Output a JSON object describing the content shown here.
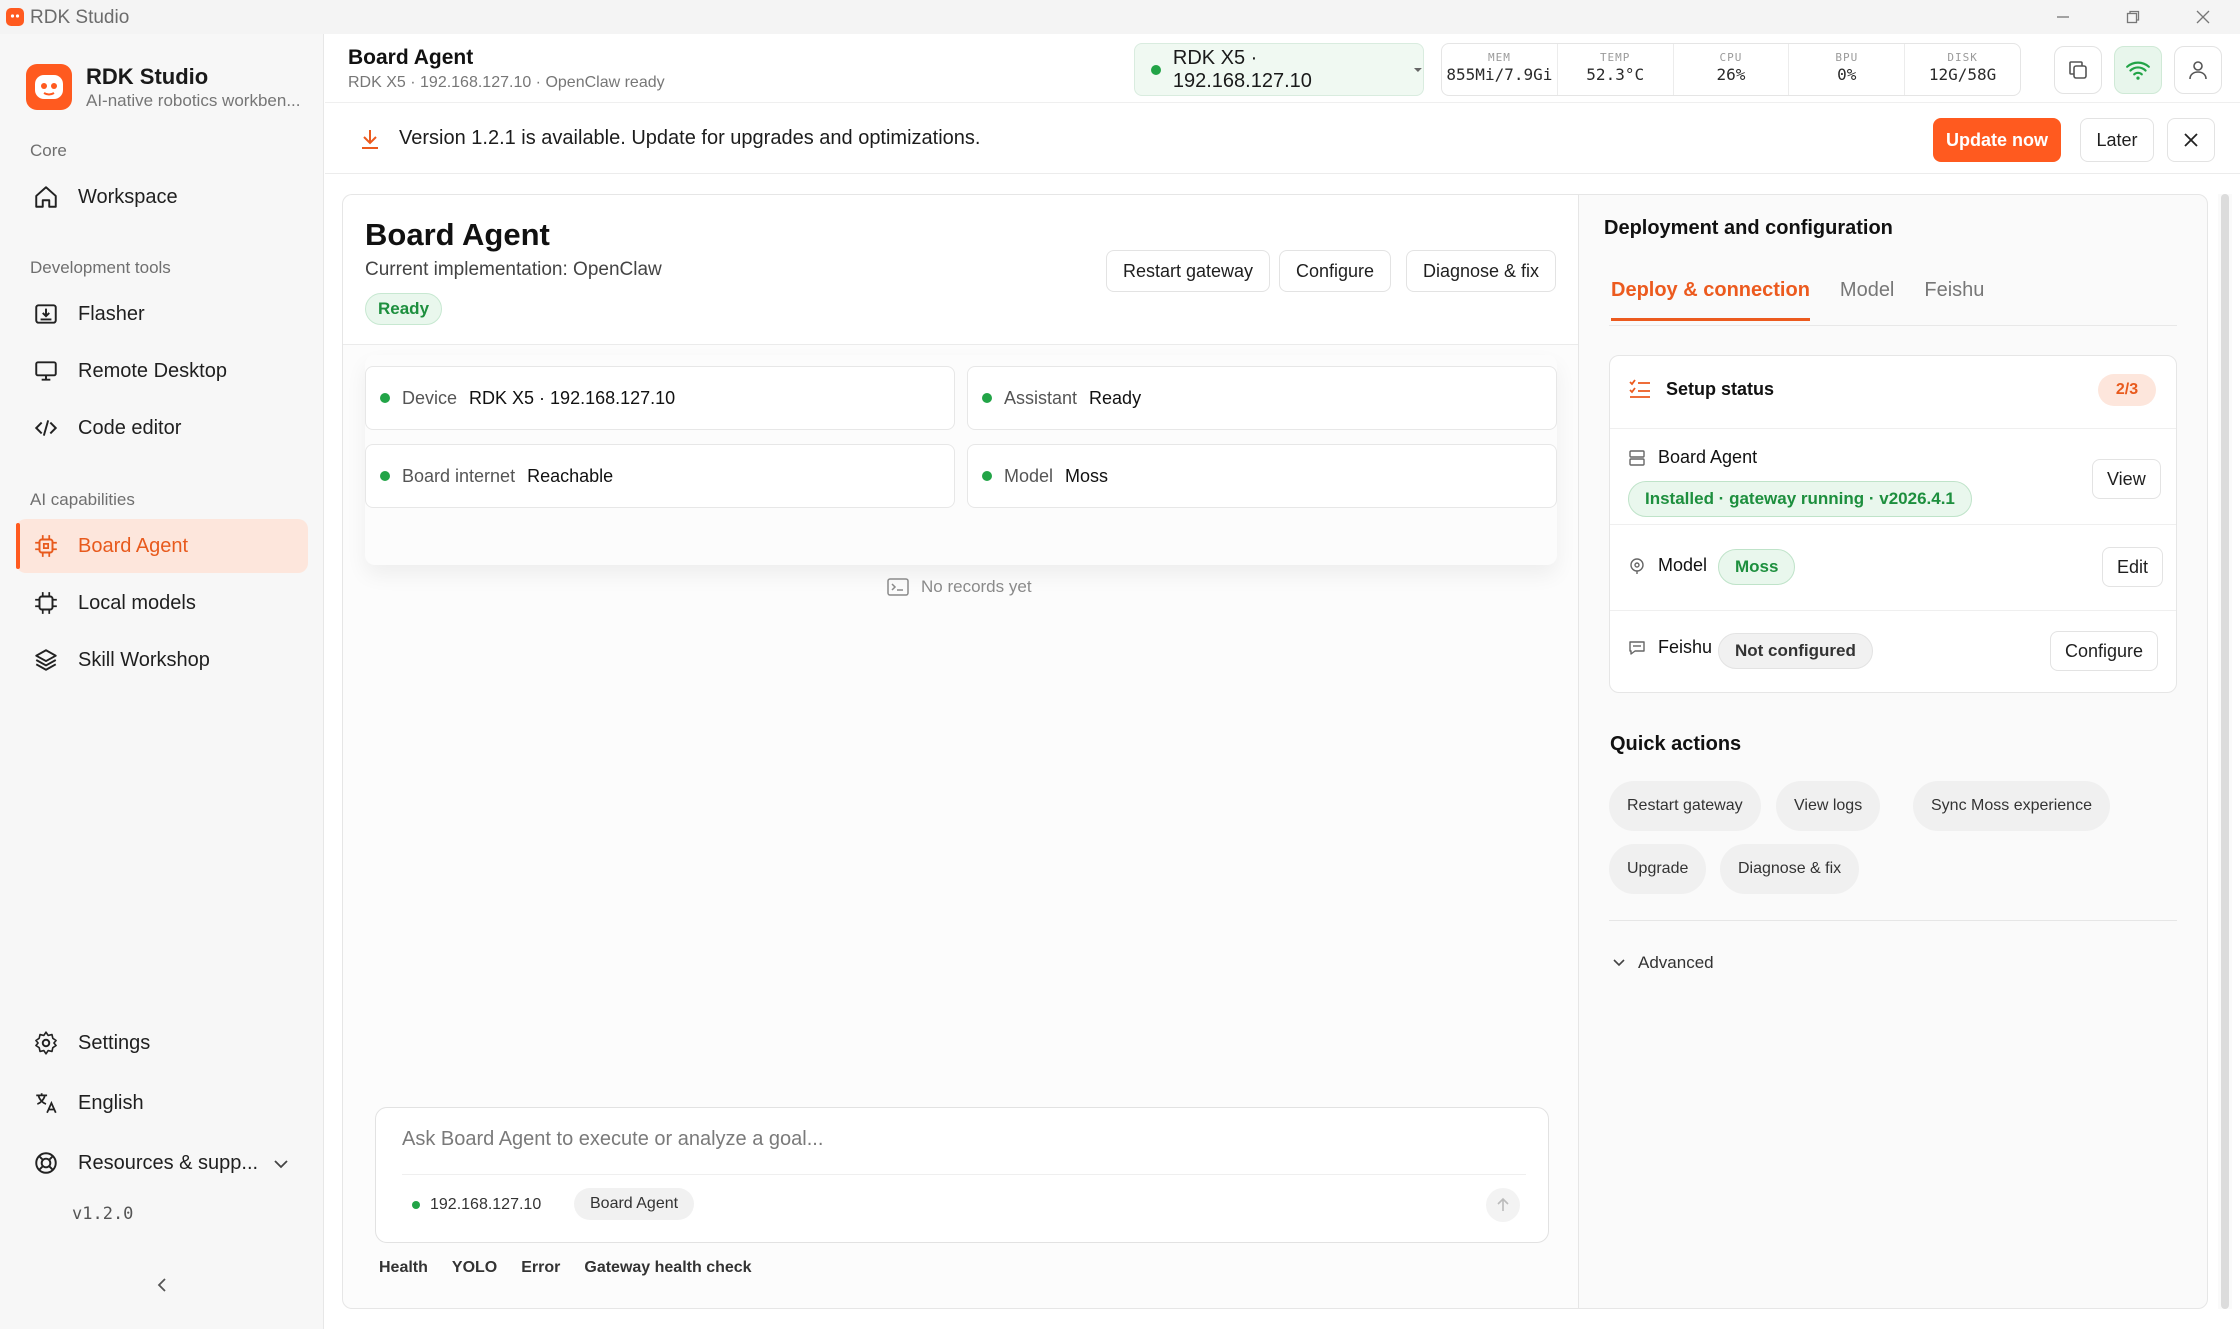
{
  "window": {
    "title": "RDK Studio"
  },
  "sidebar": {
    "brand_title": "RDK Studio",
    "brand_subtitle": "AI-native robotics workben...",
    "sections": {
      "core": "Core",
      "dev_tools": "Development tools",
      "ai": "AI capabilities"
    },
    "items": {
      "workspace": "Workspace",
      "flasher": "Flasher",
      "remote_desktop": "Remote Desktop",
      "code_editor": "Code editor",
      "board_agent": "Board Agent",
      "local_models": "Local models",
      "skill_workshop": "Skill Workshop",
      "settings": "Settings",
      "language": "English",
      "resources": "Resources & supp..."
    },
    "version": "v1.2.0"
  },
  "header": {
    "title": "Board Agent",
    "subtitle": "RDK X5 · 192.168.127.10 · OpenClaw ready",
    "device": "RDK X5 · 192.168.127.10",
    "stats": [
      {
        "key": "MEM",
        "value": "855Mi/7.9Gi"
      },
      {
        "key": "TEMP",
        "value": "52.3°C"
      },
      {
        "key": "CPU",
        "value": "26%"
      },
      {
        "key": "BPU",
        "value": "0%"
      },
      {
        "key": "DISK",
        "value": "12G/58G"
      }
    ]
  },
  "banner": {
    "text": "Version 1.2.1 is available. Update for upgrades and optimizations.",
    "update": "Update now",
    "later": "Later"
  },
  "main": {
    "title": "Board Agent",
    "implementation": "Current implementation: OpenClaw",
    "status": "Ready",
    "buttons": {
      "restart": "Restart gateway",
      "configure": "Configure",
      "diagnose": "Diagnose & fix"
    },
    "cards": {
      "device": {
        "k": "Device",
        "v": "RDK X5 · 192.168.127.10"
      },
      "assistant": {
        "k": "Assistant",
        "v": "Ready"
      },
      "internet": {
        "k": "Board internet",
        "v": "Reachable"
      },
      "model": {
        "k": "Model",
        "v": "Moss"
      }
    },
    "no_records": "No records yet",
    "composer": {
      "placeholder": "Ask Board Agent to execute or analyze a goal...",
      "ip": "192.168.127.10",
      "chip": "Board Agent"
    },
    "quick_links": [
      "Health",
      "YOLO",
      "Error",
      "Gateway health check"
    ]
  },
  "right": {
    "title": "Deployment and configuration",
    "tabs": [
      "Deploy & connection",
      "Model",
      "Feishu"
    ],
    "setup": {
      "title": "Setup status",
      "count": "2/3",
      "board_agent_label": "Board Agent",
      "board_agent_status": "Installed · gateway running · v2026.4.1",
      "view": "View",
      "model_label": "Model",
      "model_value": "Moss",
      "edit": "Edit",
      "feishu_label": "Feishu",
      "feishu_value": "Not configured",
      "configure": "Configure"
    },
    "quick_actions_title": "Quick actions",
    "quick_actions": [
      "Restart gateway",
      "View logs",
      "Sync Moss experience",
      "Upgrade",
      "Diagnose & fix"
    ],
    "advanced": "Advanced"
  },
  "colors": {
    "accent": "#ff5a1f",
    "success": "#22a447",
    "accent_soft": "#fde6dc"
  }
}
